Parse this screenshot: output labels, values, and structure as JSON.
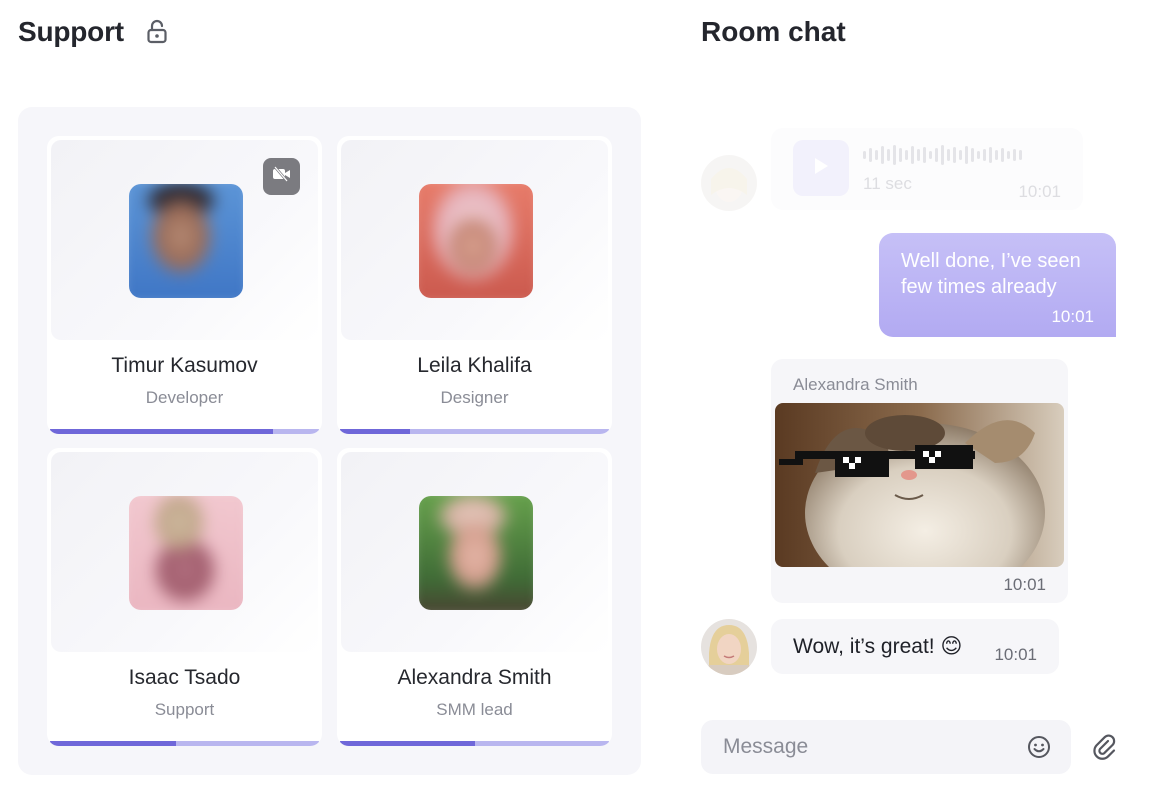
{
  "support": {
    "title": "Support",
    "members": [
      {
        "name": "Timur Kasumov",
        "role": "Developer",
        "progress": 0.83,
        "camera_off": true
      },
      {
        "name": "Leila Khalifa",
        "role": "Designer",
        "progress": 0.26,
        "camera_off": false
      },
      {
        "name": "Isaac Tsado",
        "role": "Support",
        "progress": 0.47,
        "camera_off": false
      },
      {
        "name": "Alexandra Smith",
        "role": "SMM lead",
        "progress": 0.5,
        "camera_off": false
      }
    ]
  },
  "chat": {
    "title": "Room chat",
    "voice_message": {
      "duration": "11 sec",
      "time": "10:01"
    },
    "outgoing_message": {
      "text": "Well done, I’ve seen few times already",
      "time": "10:01"
    },
    "image_message": {
      "sender": "Alexandra Smith",
      "time": "10:01"
    },
    "text_message": {
      "text": "Wow, it’s great! 😊",
      "time": "10:01"
    },
    "input": {
      "placeholder": "Message"
    }
  },
  "colors": {
    "accent": "#6f67d9",
    "accent_light": "#b9b6ef",
    "bubble_out": "#b8b0f4",
    "panel_bg": "#f6f6fa"
  },
  "icons": {
    "lock": "lock-open-icon",
    "camera_off": "video-off-icon",
    "play": "play-icon",
    "emoji": "smiley-icon",
    "attach": "paperclip-icon"
  }
}
